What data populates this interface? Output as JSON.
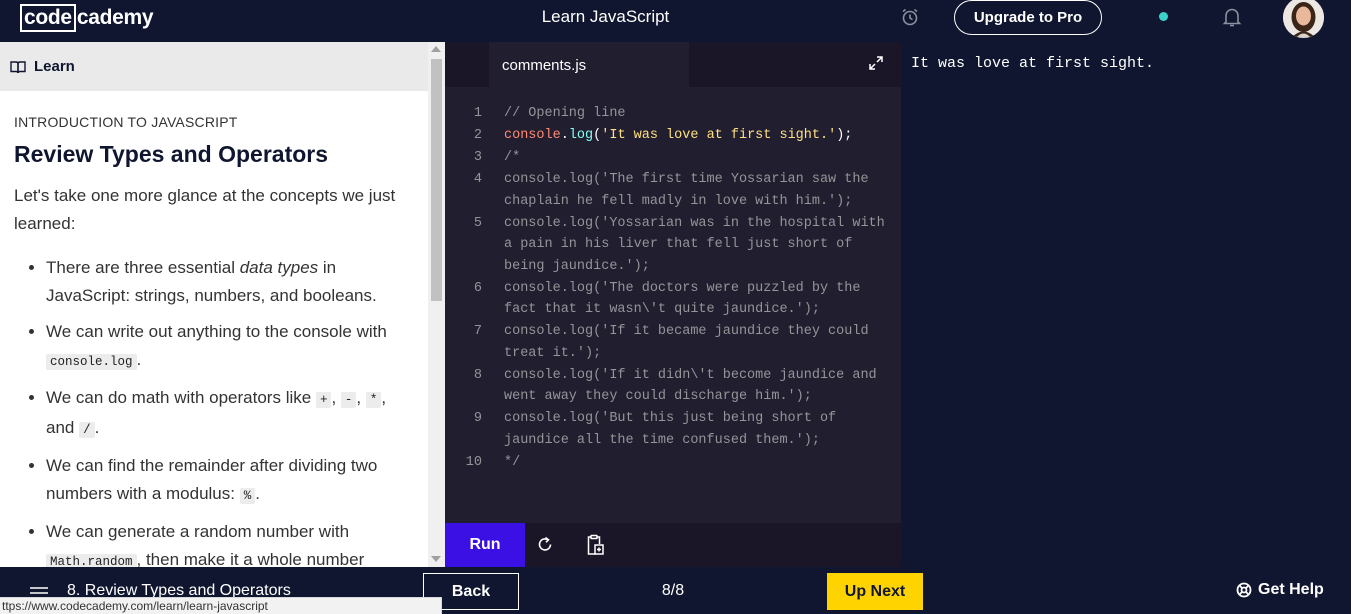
{
  "topbar": {
    "logo_box": "code",
    "logo_rest": "cademy",
    "title": "Learn JavaScript",
    "upgrade_label": "Upgrade to Pro",
    "icons": [
      "alarm-clock-icon",
      "notification-dot",
      "bell-icon",
      "user-avatar"
    ],
    "colors": {
      "background": "#10162f",
      "status_dot": "#3ad3c9"
    }
  },
  "learn": {
    "header_label": "Learn",
    "eyebrow": "INTRODUCTION TO JAVASCRIPT",
    "title": "Review Types and Operators",
    "intro": "Let's take one more glance at the concepts we just learned:",
    "b1_pre": "There are three essential ",
    "b1_em": "data types",
    "b1_post": " in JavaScript: strings, numbers, and booleans.",
    "b2_pre": "We can write out anything to the console with ",
    "b2_code": "console.log",
    "b2_post": ".",
    "b3_pre": "We can do math with operators like ",
    "b3_op1": "+",
    "b3_sep1": ", ",
    "b3_op2": "-",
    "b3_sep2": ", ",
    "b3_op3": "*",
    "b3_sep3": ", and ",
    "b3_op4": "/",
    "b3_post": ".",
    "b4_pre": "We can find the remainder after dividing two numbers with a modulus: ",
    "b4_code": "%",
    "b4_post": ".",
    "b5_pre": "We can generate a random number with ",
    "b5_code": "Math.random",
    "b5_post": ", then make it a whole number"
  },
  "editor": {
    "tab_label": "comments.js",
    "line_numbers": [
      "1",
      "2",
      "3",
      "4",
      "5",
      "6",
      "7",
      "8",
      "9",
      "10"
    ],
    "line1": "// Opening line",
    "line2_obj": "console",
    "line2_dot": ".",
    "line2_fn": "log",
    "line2_open": "(",
    "line2_str": "'It was love at first sight.'",
    "line2_close": ");",
    "line3": "/*",
    "line4": "console.log('The first time Yossarian saw the chaplain he fell madly in love with him.');",
    "line5": "console.log('Yossarian was in the hospital with a pain in his liver that fell just short of being jaundice.');",
    "line6": "console.log('The doctors were puzzled by the fact that it wasn\\'t quite jaundice.');",
    "line7": "console.log('If it became jaundice they could treat it.');",
    "line8": "console.log('If it didn\\'t become jaundice and went away they could discharge him.');",
    "line9": "console.log('But this just being short of jaundice all the time confused them.');",
    "line10": "*/",
    "run_label": "Run",
    "colors": {
      "run_button": "#3a10e5",
      "editor_bg": "#211e2f"
    }
  },
  "output": {
    "text": "It was love at first sight."
  },
  "bottombar": {
    "lesson_label": "8. Review Types and Operators",
    "back_label": "Back",
    "progress": "8/8",
    "next_label": "Up Next",
    "help_label": "Get Help",
    "colors": {
      "next_button": "#ffd300"
    }
  },
  "statusbar": {
    "url": "ttps://www.codecademy.com/learn/learn-javascript"
  }
}
